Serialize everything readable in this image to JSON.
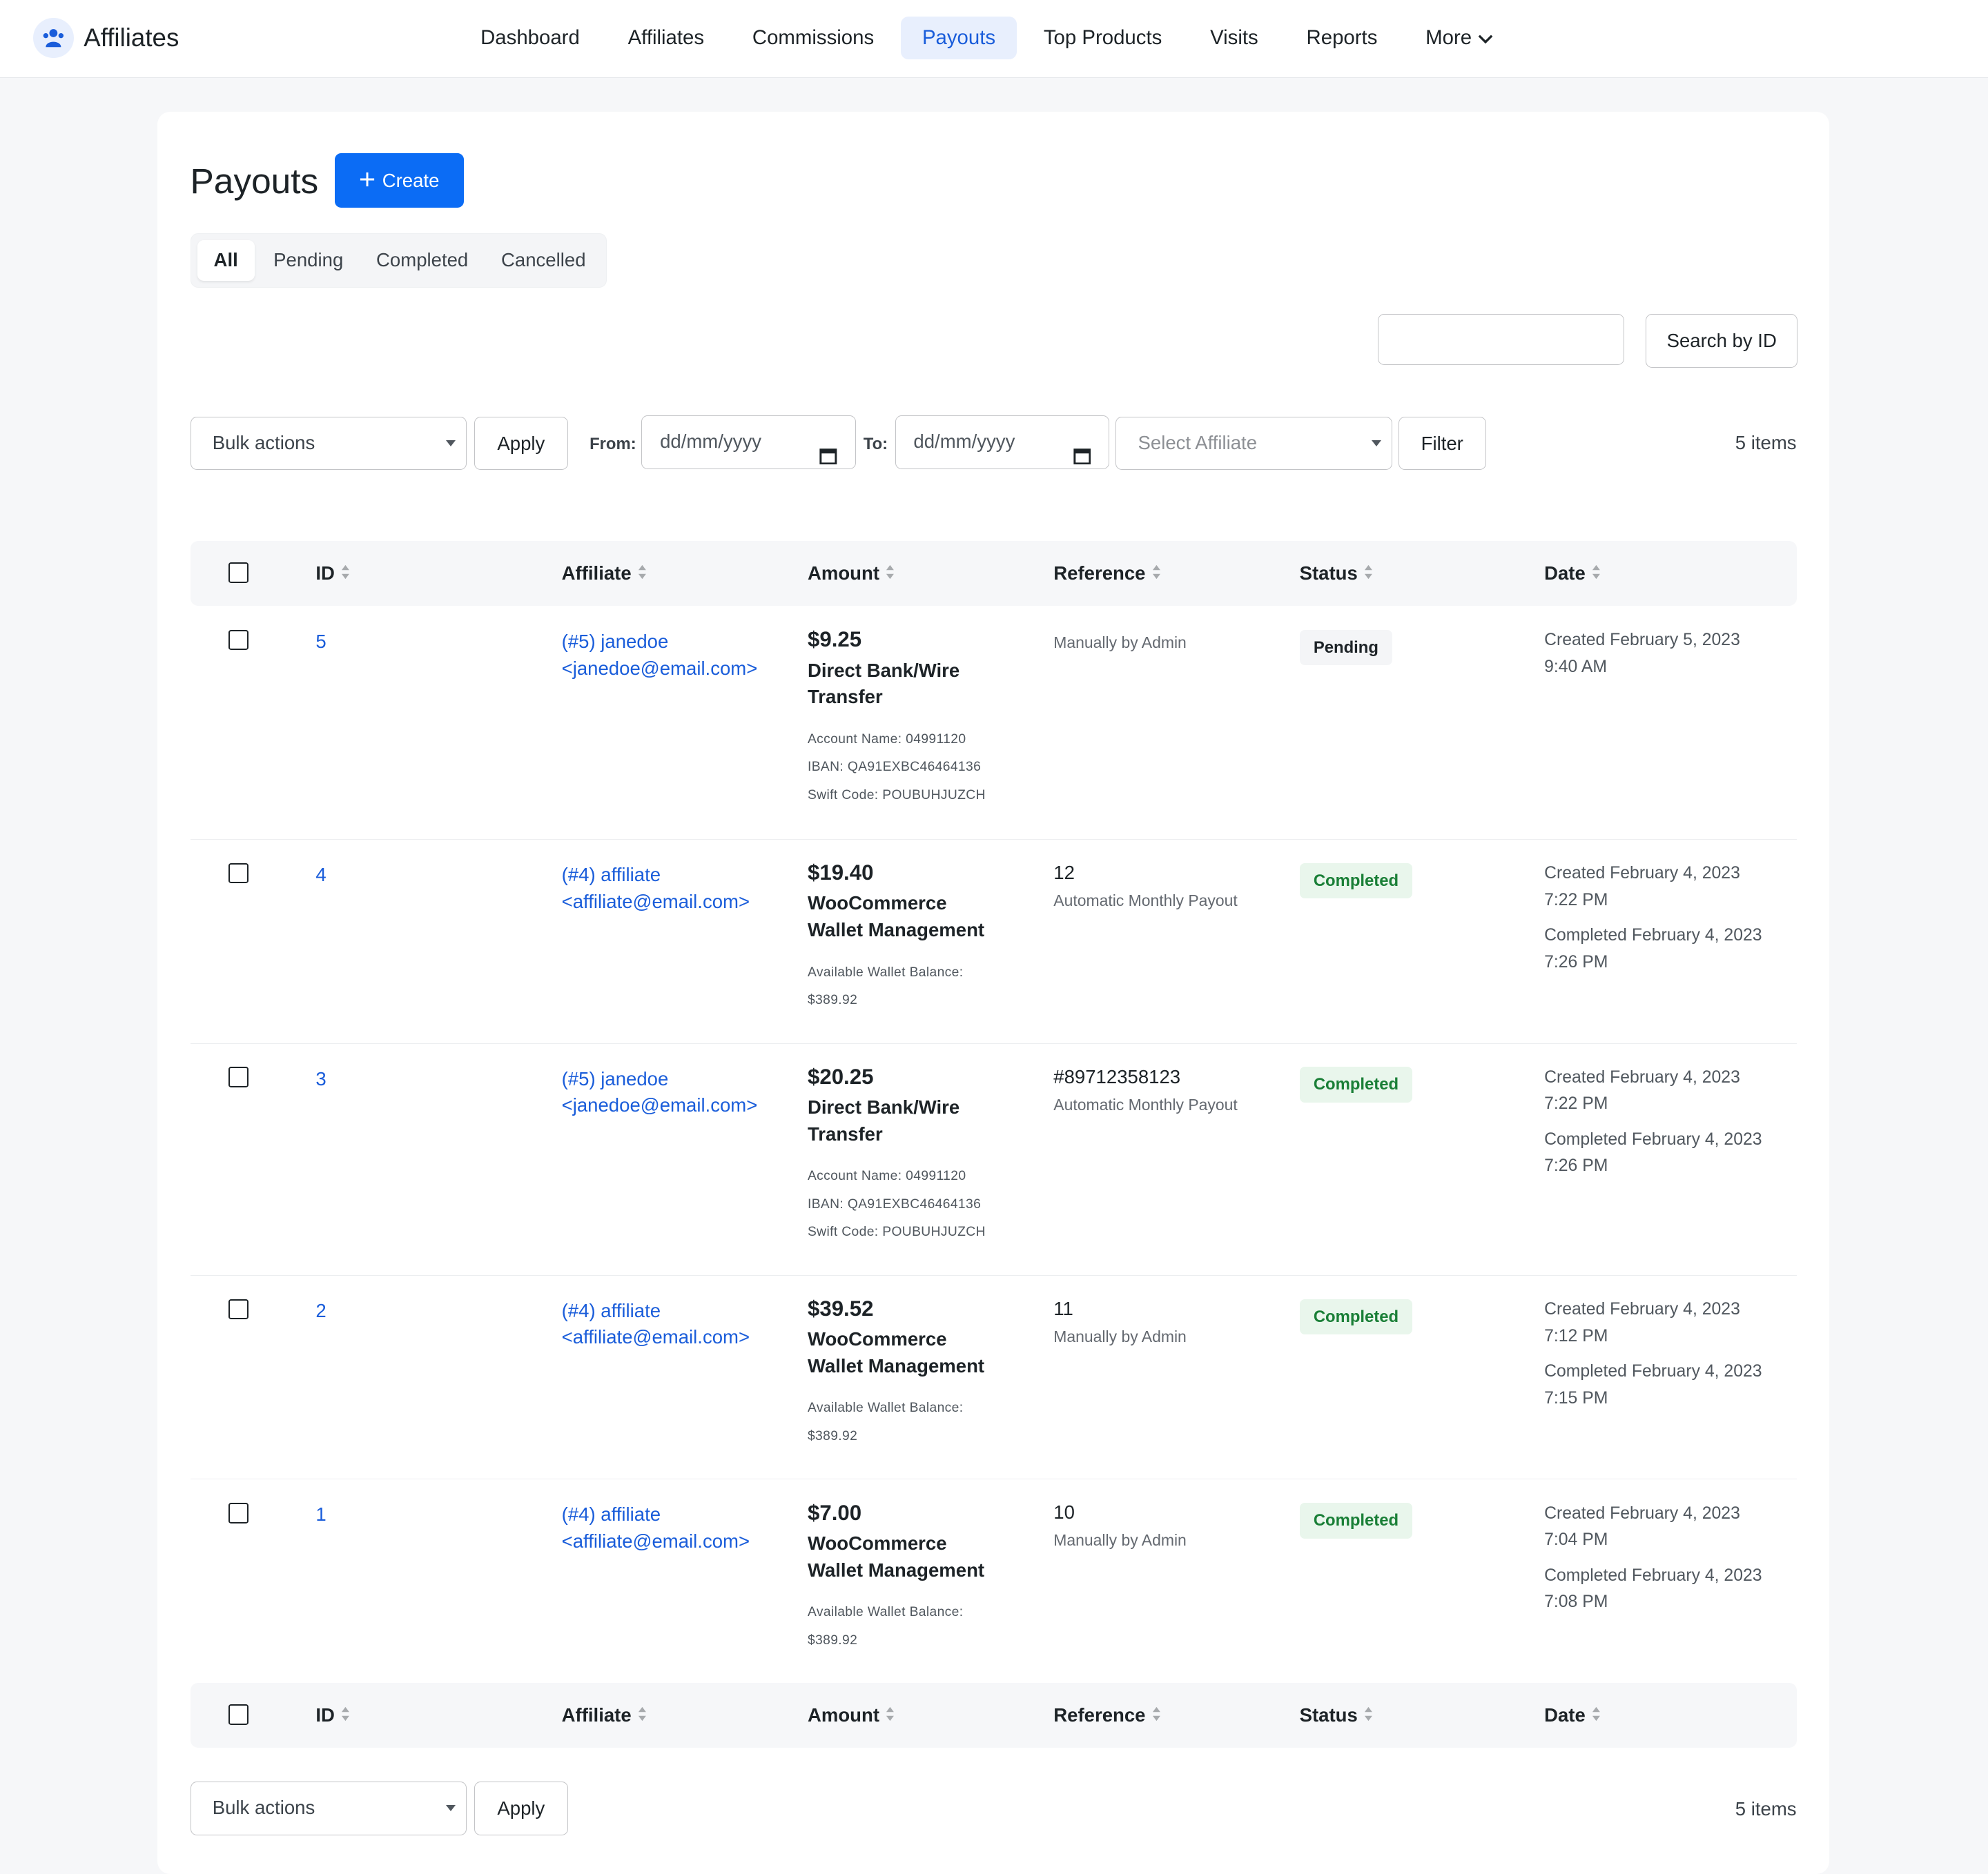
{
  "app": {
    "name": "Affiliates"
  },
  "nav": {
    "items": [
      {
        "label": "Dashboard"
      },
      {
        "label": "Affiliates"
      },
      {
        "label": "Commissions"
      },
      {
        "label": "Payouts"
      },
      {
        "label": "Top Products"
      },
      {
        "label": "Visits"
      },
      {
        "label": "Reports"
      },
      {
        "label": "More"
      }
    ],
    "active": "Payouts"
  },
  "page": {
    "title": "Payouts",
    "create_label": "Create"
  },
  "tabs": [
    {
      "label": "All"
    },
    {
      "label": "Pending"
    },
    {
      "label": "Completed"
    },
    {
      "label": "Cancelled"
    }
  ],
  "search": {
    "value": "",
    "button_label": "Search by ID"
  },
  "filters": {
    "bulk_actions": "Bulk actions",
    "apply_label": "Apply",
    "from_label": "From:",
    "to_label": "To:",
    "from_placeholder": "dd/mm/yyyy",
    "to_placeholder": "dd/mm/yyyy",
    "affiliate_placeholder": "Select Affiliate",
    "filter_label": "Filter",
    "count": "5 items"
  },
  "table": {
    "columns": [
      "ID",
      "Affiliate",
      "Amount",
      "Reference",
      "Status",
      "Date"
    ],
    "rows": [
      {
        "id": "5",
        "affiliate_line1": "(#5) janedoe",
        "affiliate_line2": "<janedoe@email.com>",
        "amount": "$9.25",
        "method_line1": "Direct Bank/Wire",
        "method_line2": "Transfer",
        "details": [
          "Account Name: 04991120",
          "IBAN: QA91EXBC46464136",
          "Swift Code: POUBUHJUZCH"
        ],
        "reference": "",
        "reference_note": "Manually by Admin",
        "status": "Pending",
        "created_label": "Created February 5, 2023",
        "created_time": "9:40 AM",
        "completed_label": "",
        "completed_time": ""
      },
      {
        "id": "4",
        "affiliate_line1": "(#4) affiliate",
        "affiliate_line2": "<affiliate@email.com>",
        "amount": "$19.40",
        "method_line1": "WooCommerce",
        "method_line2": "Wallet Management",
        "details": [
          "Available Wallet Balance:",
          "$389.92"
        ],
        "reference": "12",
        "reference_note": "Automatic Monthly Payout",
        "status": "Completed",
        "created_label": "Created February 4, 2023",
        "created_time": "7:22 PM",
        "completed_label": "Completed February 4, 2023",
        "completed_time": "7:26 PM"
      },
      {
        "id": "3",
        "affiliate_line1": "(#5) janedoe",
        "affiliate_line2": "<janedoe@email.com>",
        "amount": "$20.25",
        "method_line1": "Direct Bank/Wire",
        "method_line2": "Transfer",
        "details": [
          "Account Name: 04991120",
          "IBAN: QA91EXBC46464136",
          "Swift Code: POUBUHJUZCH"
        ],
        "reference": "#89712358123",
        "reference_note": "Automatic Monthly Payout",
        "status": "Completed",
        "created_label": "Created February 4, 2023",
        "created_time": "7:22 PM",
        "completed_label": "Completed February 4, 2023",
        "completed_time": "7:26 PM"
      },
      {
        "id": "2",
        "affiliate_line1": "(#4) affiliate",
        "affiliate_line2": "<affiliate@email.com>",
        "amount": "$39.52",
        "method_line1": "WooCommerce",
        "method_line2": "Wallet Management",
        "details": [
          "Available Wallet Balance:",
          "$389.92"
        ],
        "reference": "11",
        "reference_note": "Manually by Admin",
        "status": "Completed",
        "created_label": "Created February 4, 2023",
        "created_time": "7:12 PM",
        "completed_label": "Completed February 4, 2023",
        "completed_time": "7:15 PM"
      },
      {
        "id": "1",
        "affiliate_line1": "(#4) affiliate",
        "affiliate_line2": "<affiliate@email.com>",
        "amount": "$7.00",
        "method_line1": "WooCommerce",
        "method_line2": "Wallet Management",
        "details": [
          "Available Wallet Balance:",
          "$389.92"
        ],
        "reference": "10",
        "reference_note": "Manually by Admin",
        "status": "Completed",
        "created_label": "Created February 4, 2023",
        "created_time": "7:04 PM",
        "completed_label": "Completed February 4, 2023",
        "completed_time": "7:08 PM"
      }
    ]
  },
  "colors": {
    "accent": "#0b6cf5",
    "link": "#1a5dda",
    "completed_bg": "#e9f6ec",
    "completed_text": "#1a7f37"
  },
  "icons": {
    "logo": "affiliate-people-icon",
    "create": "plus-icon",
    "more": "chevron-down-icon",
    "sort": "sort-arrows-icon",
    "calendar": "calendar-icon"
  }
}
